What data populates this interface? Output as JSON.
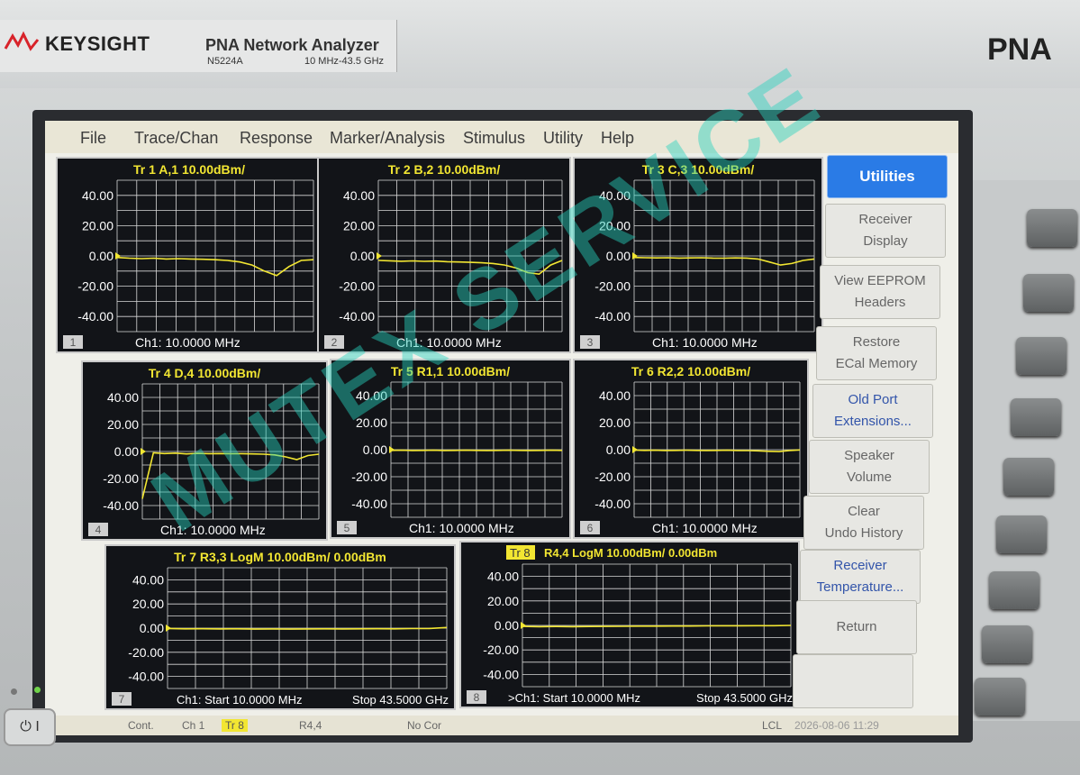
{
  "instrument": {
    "brand": "KEYSIGHT",
    "title": "PNA Network Analyzer",
    "model": "N5224A",
    "freq_range": "10 MHz-43.5 GHz",
    "series": "PNA"
  },
  "menu": [
    "File",
    "Trace/Chan",
    "Response",
    "Marker/Analysis",
    "Stimulus",
    "Utility",
    "Help"
  ],
  "softkeys": [
    {
      "lines": [
        "Utilities"
      ],
      "state": "active"
    },
    {
      "lines": [
        "Receiver",
        "Display"
      ],
      "state": "normal"
    },
    {
      "lines": [
        "View EEPROM",
        "Headers"
      ],
      "state": "normal"
    },
    {
      "lines": [
        "Restore",
        "ECal Memory"
      ],
      "state": "normal"
    },
    {
      "lines": [
        "Old Port",
        "Extensions..."
      ],
      "state": "blue"
    },
    {
      "lines": [
        "Speaker",
        "Volume"
      ],
      "state": "normal"
    },
    {
      "lines": [
        "Clear",
        "Undo History"
      ],
      "state": "normal"
    },
    {
      "lines": [
        "Receiver",
        "Temperature..."
      ],
      "state": "blue"
    },
    {
      "lines": [
        "Return"
      ],
      "state": "normal"
    },
    {
      "lines": [
        ""
      ],
      "state": "normal"
    }
  ],
  "y_ticks": [
    "40.00",
    "20.00",
    "0.00",
    "-20.00",
    "-40.00"
  ],
  "y_values": [
    40,
    20,
    0,
    -20,
    -40
  ],
  "ylim": [
    -50,
    50
  ],
  "colors": {
    "trace": "#f2e632",
    "grid": "#d8d8d8",
    "title": "#f2e632",
    "bg": "#121418",
    "accent": "#2a7be6"
  },
  "windows": [
    {
      "num": "1",
      "title": "Tr 1  A,1 10.00dBm/",
      "footer": "Ch1:  10.0000 MHz",
      "trace": [
        -1,
        -1.5,
        -1.8,
        -1.5,
        -2,
        -1.8,
        -2,
        -2.2,
        -2.5,
        -3,
        -4,
        -6,
        -10,
        -13,
        -7,
        -3,
        -2.5
      ]
    },
    {
      "num": "2",
      "title": "Tr 2  B,2 10.00dBm/",
      "footer": "Ch1:  10.0000 MHz",
      "trace": [
        -3,
        -3.2,
        -3.5,
        -3.3,
        -3.6,
        -3.4,
        -3.8,
        -4,
        -4.2,
        -4.5,
        -5,
        -6,
        -8,
        -11,
        -12,
        -6,
        -3
      ]
    },
    {
      "num": "3",
      "title": "Tr 3  C,3 10.00dBm/",
      "footer": "Ch1:  10.0000 MHz",
      "trace": [
        -1,
        -1.2,
        -1.3,
        -1.2,
        -1.4,
        -1.3,
        -1.2,
        -1.4,
        -1.5,
        -1.3,
        -1.4,
        -2,
        -4,
        -6,
        -5,
        -3,
        -2
      ]
    },
    {
      "num": "4",
      "title": "Tr 4  D,4 10.00dBm/",
      "footer": "Ch1:  10.0000 MHz",
      "trace": [
        -35,
        -1,
        -1.5,
        -1.2,
        -1.8,
        -1.4,
        -1.6,
        -1.5,
        -1.7,
        -1.6,
        -1.8,
        -2,
        -2.5,
        -4,
        -6,
        -3,
        -2
      ]
    },
    {
      "num": "5",
      "title": "Tr 5  R1,1 10.00dBm/",
      "footer": "Ch1:  10.0000 MHz",
      "trace": [
        -0.5,
        -0.4,
        -0.6,
        -0.5,
        -0.4,
        -0.6,
        -0.5,
        -0.4,
        -0.5,
        -0.6,
        -0.5,
        -0.4,
        -0.5,
        -0.6,
        -0.5,
        -0.4,
        -0.5
      ]
    },
    {
      "num": "6",
      "title": "Tr 6  R2,2 10.00dBm/",
      "footer": "Ch1:  10.0000 MHz",
      "trace": [
        -0.3,
        -0.5,
        -0.4,
        -0.6,
        -0.5,
        -0.4,
        -0.5,
        -0.6,
        -0.5,
        -0.4,
        -0.6,
        -0.7,
        -0.9,
        -1.2,
        -1.4,
        -0.6,
        -0.2
      ]
    },
    {
      "num": "7",
      "title": "Tr 7  R3,3 LogM 10.00dBm/  0.00dBm",
      "footer_start": "Ch1:  Start  10.0000 MHz",
      "footer_stop": "Stop  43.5000 GHz",
      "trace": [
        -0.3,
        -0.6,
        -0.5,
        -0.7,
        -0.6,
        -0.8,
        -0.7,
        -0.8,
        -0.7,
        -0.6,
        -0.7,
        -0.6,
        -0.5,
        -0.6,
        -0.4,
        -0.3,
        0.5
      ]
    },
    {
      "num": "8",
      "title": "Tr 8",
      "title_rest": "R4,4 LogM 10.00dBm/  0.00dBm",
      "footer_start": ">Ch1:  Start  10.0000 MHz",
      "footer_stop": "Stop  43.5000 GHz",
      "trace": [
        -0.8,
        -1,
        -0.9,
        -1,
        -0.9,
        -0.8,
        -0.7,
        -0.6,
        -0.6,
        -0.5,
        -0.5,
        -0.4,
        -0.3,
        -0.3,
        -0.2,
        -0.2,
        0
      ]
    }
  ],
  "status": {
    "cont": "Cont.",
    "channel": "Ch 1",
    "trace": "Tr 8",
    "receiver": "R4,4",
    "correction": "No Cor",
    "lcl": "LCL",
    "datetime": "2026-08-06 11:29"
  },
  "watermark": "MUTEX SERVICE"
}
